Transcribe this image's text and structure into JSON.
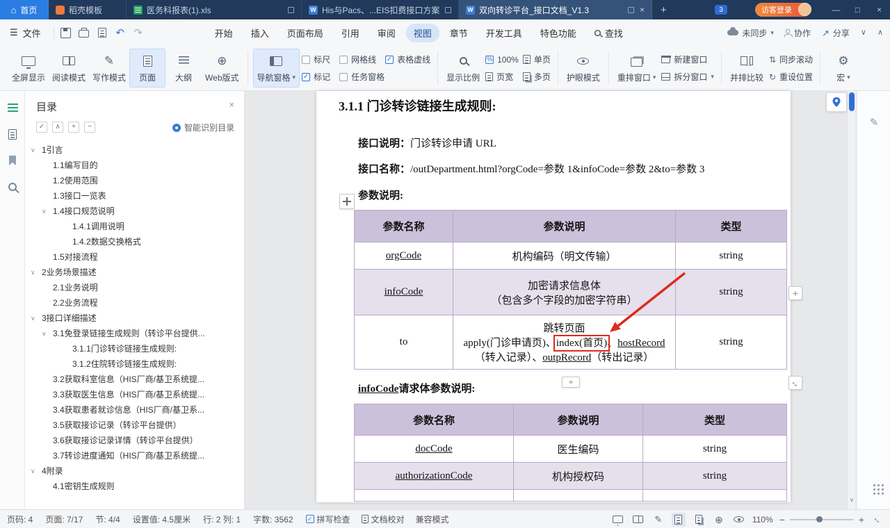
{
  "colors": {
    "titlebar_bg": "#21395b",
    "home_tab_blue": "#2b7de4",
    "login_orange": "#e85638",
    "accent_blue": "#2f6fd6",
    "table_header_purple": "#ccc1da",
    "table_row_alt": "#e6e0ec",
    "annotation_red": "#dd2b1c",
    "nav_active_green": "#27a376"
  },
  "icons": {
    "hamburger": "☰",
    "home": "⌂",
    "close": "×",
    "min": "—",
    "max": "□",
    "plus": "+",
    "minus": "−",
    "dropdown": "▾",
    "chev_down": "∨",
    "chev_up": "∧",
    "undo": "↶",
    "redo": "↷",
    "pen": "✎",
    "gear": "⚙",
    "globe": "⊕",
    "check": "✓",
    "sync_scroll": "⇅",
    "reset": "↻",
    "share_arrow": "↗",
    "percent": "%",
    "w_letter": "W",
    "diag_arrow": "↔"
  },
  "titlebar": {
    "home_tab": "首页",
    "docer_tab": "稻壳模板",
    "tabs": [
      {
        "title": "医务科报表(1).xls"
      },
      {
        "title": "His与Pacs、...EIS扣费接口方案"
      },
      {
        "title": "双向转诊平台_接口文档_V1.3"
      }
    ],
    "badge": "3",
    "login": "访客登录"
  },
  "menubar": {
    "file": "文件",
    "items": [
      "开始",
      "插入",
      "页面布局",
      "引用",
      "审阅",
      "视图",
      "章节",
      "开发工具",
      "特色功能"
    ],
    "find": "查找",
    "sync_status": "未同步",
    "collab": "协作",
    "share": "分享"
  },
  "ribbon": {
    "fullscreen": "全屏显示",
    "read_mode": "阅读模式",
    "write_mode": "写作模式",
    "page_view": "页面",
    "outline_view": "大纲",
    "web_view": "Web版式",
    "nav_pane": "导航窗格",
    "checkboxes": [
      {
        "label": "标尺"
      },
      {
        "label": "网格线"
      },
      {
        "label": "表格虚线"
      },
      {
        "label": "标记"
      },
      {
        "label": "任务窗格"
      }
    ],
    "zoom_tool": "显示比例",
    "zoom_value": "100%",
    "page_width": "页宽",
    "single_page": "单页",
    "multi_page": "多页",
    "eye_mode": "护眼模式",
    "rearrange": "重排窗口",
    "new_window": "新建窗口",
    "split_window": "拆分窗口",
    "side_by_side": "并排比较",
    "sync_scroll": "同步滚动",
    "reset_position": "重设位置",
    "macro": "宏"
  },
  "nav": {
    "title": "目录",
    "smart_label": "智能识别目录",
    "items": [
      {
        "label": "1引言"
      },
      {
        "label": "1.1编写目的"
      },
      {
        "label": "1.2使用范围"
      },
      {
        "label": "1.3接口一览表"
      },
      {
        "label": "1.4接口规范说明"
      },
      {
        "label": "1.4.1调用说明"
      },
      {
        "label": "1.4.2数据交换格式"
      },
      {
        "label": "1.5对接流程"
      },
      {
        "label": "2业务场景描述"
      },
      {
        "label": "2.1业务说明"
      },
      {
        "label": "2.2业务流程"
      },
      {
        "label": "3接口详细描述"
      },
      {
        "label": "3.1免登录链接生成规则（转诊平台提供..."
      },
      {
        "label": "3.1.1门诊转诊链接生成规则:"
      },
      {
        "label": "3.1.2住院转诊链接生成规则:"
      },
      {
        "label": "3.2获取科室信息（HIS厂商/基卫系统提..."
      },
      {
        "label": "3.3获取医生信息（HIS厂商/基卫系统提..."
      },
      {
        "label": "3.4获取患者就诊信息（HIS厂商/基卫系..."
      },
      {
        "label": "3.5获取接诊记录（转诊平台提供）"
      },
      {
        "label": "3.6获取接诊记录详情（转诊平台提供）"
      },
      {
        "label": "3.7转诊进度通知（HIS厂商/基卫系统提..."
      },
      {
        "label": "4附录"
      },
      {
        "label": "4.1密钥生成规则"
      }
    ]
  },
  "doc": {
    "heading": "3.1.1 门诊转诊链接生成规则:",
    "desc_label": "接口说明：",
    "desc_text": "门诊转诊申请 URL",
    "name_label": "接口名称：",
    "name_text": "/outDepartment.html?orgCode=参数 1&infoCode=参数 2&to=参数 3",
    "param_title": "参数说明:",
    "table1": {
      "headers": [
        "参数名称",
        "参数说明",
        "类型"
      ],
      "rows": [
        {
          "name": "orgCode",
          "desc": "机构编码（明文传输）",
          "type": "string"
        },
        {
          "name": "infoCode",
          "desc_l1": "加密请求信息体",
          "desc_l2": "（包含多个字段的加密字符串）",
          "type": "string"
        },
        {
          "name": "to",
          "type": "string",
          "desc_l1": "跳转页面",
          "desc_l2a": "apply(门诊申请页)、",
          "desc_l2b": "index(首页)",
          "desc_l2c": "、",
          "desc_l2d": "hostRecord",
          "desc_l3a": "（转入记录）、",
          "desc_l3b": "outpRecord",
          "desc_l3c": "（转出记录）"
        }
      ]
    },
    "infocode_title_code": "infoCode",
    "infocode_title_rest": "请求体参数说明:",
    "table2": {
      "headers": [
        "参数名称",
        "参数说明",
        "类型"
      ],
      "rows": [
        {
          "name": "docCode",
          "desc": "医生编码",
          "type": "string"
        },
        {
          "name": "authorizationCode",
          "desc": "机构授权码",
          "type": "string"
        }
      ]
    }
  },
  "statusbar": {
    "items": [
      "页码: 4",
      "页面: 7/17",
      "节: 4/4",
      "设置值: 4.5厘米",
      "行: 2 列: 1",
      "字数: 3562"
    ],
    "spell": "拼写检查",
    "proof": "文档校对",
    "compat": "兼容模式",
    "zoom": "110%"
  }
}
